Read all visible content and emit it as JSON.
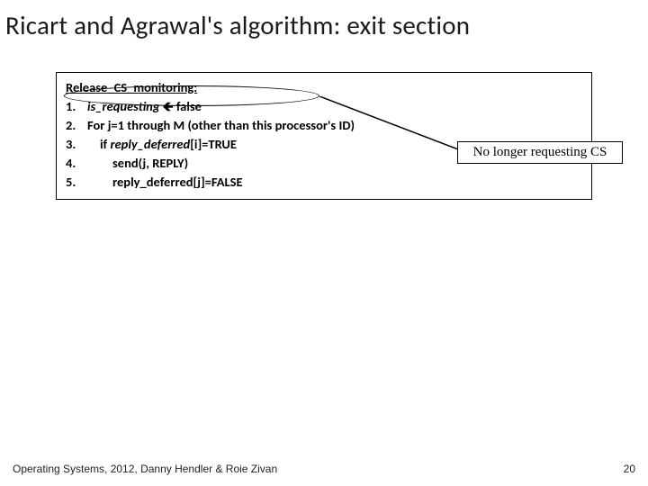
{
  "title": "Ricart and Agrawal's algorithm: exit section",
  "code": {
    "heading": "Release_CS_monitoring:",
    "lines": [
      {
        "n": "1.",
        "indent": 0,
        "html": "<span class='ital'>is_requesting</span> <span class='arrow'>🡸</span> false"
      },
      {
        "n": "2.",
        "indent": 0,
        "html": "For j=1 through M (other than this processor's ID)"
      },
      {
        "n": "3.",
        "indent": 1,
        "html": "if <span class='ital'>reply_deferred</span>[i]=TRUE"
      },
      {
        "n": "4.",
        "indent": 2,
        "html": "send(j, REPLY)"
      },
      {
        "n": "5.",
        "indent": 2,
        "html": "reply_deferred[j]=FALSE"
      }
    ]
  },
  "callout": "No longer requesting CS",
  "footer": "Operating Systems, 2012, Danny Hendler & Roie Zivan",
  "page_number": "20"
}
